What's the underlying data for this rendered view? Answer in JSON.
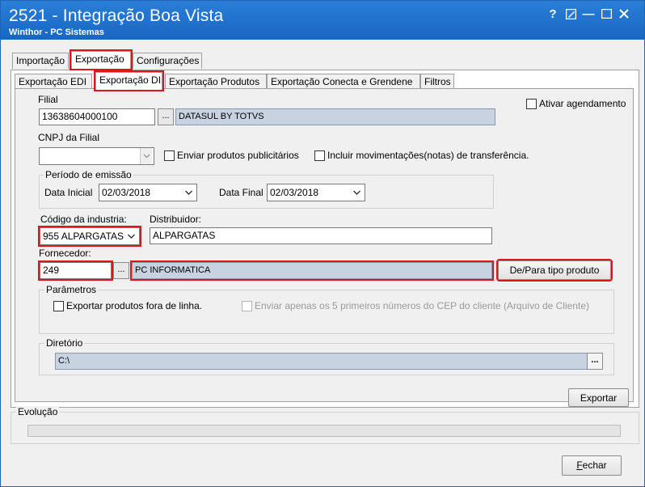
{
  "window": {
    "title": "2521 - Integração Boa Vista",
    "subtitle": "Winthor - PC Sistemas",
    "help_label": "?",
    "min_label": "—"
  },
  "main_tabs": [
    {
      "label": "Importação"
    },
    {
      "label": "Exportação"
    },
    {
      "label": "Configurações"
    }
  ],
  "sub_tabs": [
    {
      "label": "Exportação EDI"
    },
    {
      "label": "Exportação DI"
    },
    {
      "label": "Exportação Produtos"
    },
    {
      "label": "Exportação Conecta e Grendene"
    },
    {
      "label": "Filtros"
    }
  ],
  "form": {
    "filial_label": "Filial",
    "filial_code": "13638604000100",
    "filial_name": "DATASUL BY TOTVS",
    "agendamento_label": "Ativar agendamento",
    "cnpj_label": "CNPJ da Filial",
    "cnpj_value": "",
    "enviar_produtos_label": "Enviar produtos publicitários",
    "incluir_mov_label": "Incluir movimentações(notas) de transferência.",
    "periodo_title": "Período de emissão",
    "data_inicial_label": "Data Inicial",
    "data_inicial": "02/03/2018",
    "data_final_label": "Data Final",
    "data_final": "02/03/2018",
    "codigo_industria_label": "Código da industria:",
    "codigo_industria": "955 ALPARGATAS",
    "distribuidor_label": "Distribuidor:",
    "distribuidor": "ALPARGATAS",
    "fornecedor_label": "Fornecedor:",
    "fornecedor_code": "249",
    "fornecedor_name": "PC INFORMATICA",
    "depara_button": "De/Para tipo produto",
    "parametros_title": "Parâmetros",
    "fora_linha_label": "Exportar produtos fora de linha.",
    "cep_label": "Enviar apenas os 5 primeiros números do CEP do cliente (Arquivo de Cliente)",
    "diretorio_title": "Diretório",
    "diretorio": "C:\\",
    "dots": "...",
    "exportar_button": "Exportar"
  },
  "evolucao": {
    "title": "Evolução",
    "progress": 0
  },
  "fechar_button": "Fechar"
}
